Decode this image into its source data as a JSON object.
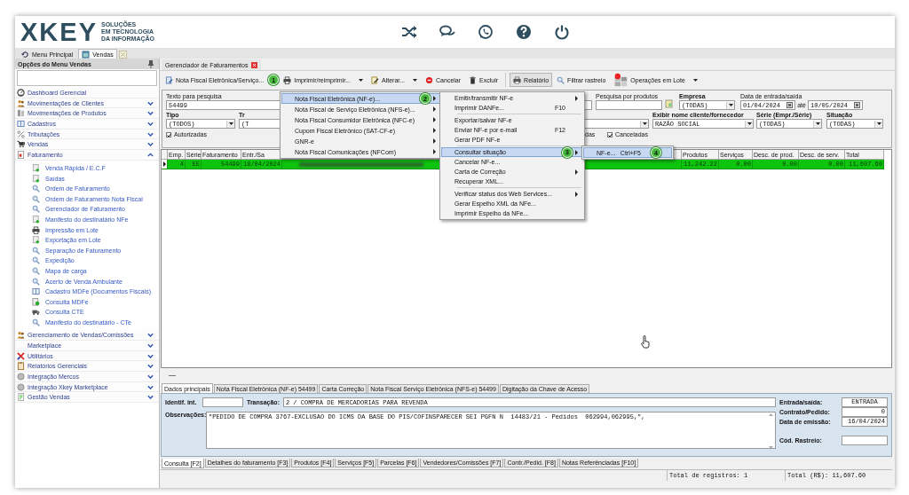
{
  "header": {
    "logo_wordmark": "XKEY",
    "logo_tagline": [
      "SOLUÇÕES",
      "EM TECNOLOGIA",
      "DA INFORMAÇÃO"
    ]
  },
  "app_tabs": [
    {
      "label": "Menu Principal",
      "selected": false
    },
    {
      "label": "Vendas",
      "selected": true
    }
  ],
  "sidebar": {
    "title": "Opções do Menu Vendas",
    "items": [
      {
        "label": "Dashboard Gerencial",
        "kind": "link"
      },
      {
        "label": "Movimentações de Clientes",
        "kind": "group",
        "expanded": false
      },
      {
        "label": "Movimentações de Produtos",
        "kind": "group",
        "expanded": false
      },
      {
        "label": "Cadastros",
        "kind": "group",
        "expanded": false
      },
      {
        "label": "Tributações",
        "kind": "group",
        "expanded": false
      },
      {
        "label": "Vendas",
        "kind": "group",
        "expanded": false
      },
      {
        "label": "Faturamento",
        "kind": "group",
        "expanded": true,
        "children": [
          {
            "label": "Venda Rápida / E.C.F",
            "kind": "add"
          },
          {
            "label": "Saídas",
            "kind": "add"
          },
          {
            "label": "Ordem de Faturamento",
            "kind": "search"
          },
          {
            "label": "Ordem de Faturamento Nota Fiscal",
            "kind": "search"
          },
          {
            "label": "Gerenciador de Faturamento",
            "kind": "search"
          },
          {
            "label": "Manifesto do destinatário NFe",
            "kind": "add"
          },
          {
            "label": "Impressão em Lote",
            "kind": "printer"
          },
          {
            "label": "Exportação em Lote",
            "kind": "add"
          },
          {
            "label": "Separação de Faturamento",
            "kind": "search"
          },
          {
            "label": "Expedição",
            "kind": "search"
          },
          {
            "label": "Mapa de carga",
            "kind": "search"
          },
          {
            "label": "Acerto de Venda Ambulante",
            "kind": "search"
          },
          {
            "label": "Cadastro MDFe (Documentos Fiscais)",
            "kind": "book"
          },
          {
            "label": "Consulta MDFe",
            "kind": "consult"
          },
          {
            "label": "Consulta CTE",
            "kind": "truck"
          },
          {
            "label": "Manifesto do destinatário - CTe",
            "kind": "search"
          }
        ]
      },
      {
        "label": "Gerenciamento de Vendas/Comissões",
        "kind": "group",
        "expanded": false
      },
      {
        "label": "Marketplace",
        "kind": "group",
        "expanded": false
      },
      {
        "label": "Utilitários",
        "kind": "group",
        "expanded": false
      },
      {
        "label": "Relatórios Gerenciais",
        "kind": "group",
        "expanded": false
      },
      {
        "label": "Integração Mercos",
        "kind": "group",
        "expanded": false
      },
      {
        "label": "Integração Xkey Marketplace",
        "kind": "group",
        "expanded": false
      },
      {
        "label": "Gestão Vendas",
        "kind": "group",
        "expanded": false
      }
    ]
  },
  "document_tab": {
    "label": "Gerenciador de Faturamentos"
  },
  "toolbar": [
    {
      "label": "Nota Fiscal Eletrônica/Serviço...",
      "kind": "nfe",
      "dropdown": false,
      "pressed": false,
      "badge": "1"
    },
    {
      "label": "Imprimir/reimprimir...",
      "kind": "print",
      "dropdown": true,
      "pressed": false
    },
    {
      "label": "Alterar...",
      "kind": "edit",
      "dropdown": true,
      "pressed": false
    },
    {
      "label": "Cancelar",
      "kind": "cancel",
      "dropdown": false,
      "pressed": false
    },
    {
      "label": "Excluir",
      "kind": "delete",
      "dropdown": false,
      "pressed": false
    },
    {
      "label": "Relatório",
      "kind": "report",
      "dropdown": false,
      "pressed": true
    },
    {
      "label": "Filtrar rastreio",
      "kind": "filter",
      "dropdown": false,
      "pressed": false
    },
    {
      "label": "Operações em Lote",
      "kind": "batch",
      "dropdown": true,
      "pressed": false
    }
  ],
  "filters": {
    "search_text": {
      "label": "Texto para pesquisa",
      "value": "54499"
    },
    "product_search": {
      "label": "Pesquisa por produtos"
    },
    "company": {
      "label": "Empresa",
      "value": "(TODAS)"
    },
    "date_range": {
      "label": "Data de entrada/saída",
      "from": "01/04/2024",
      "separator": "até",
      "to": "10/05/2024"
    },
    "type": {
      "label": "Tipo",
      "value": "(TODOS)"
    },
    "type_2": {
      "label": "Tr",
      "value": "(T"
    },
    "display_name": {
      "label": "Exibir nome cliente/fornecedor",
      "value": "RAZÃO SOCIAL"
    },
    "series": {
      "label": "Série (Empr./Série)",
      "value": "(TODAS)"
    },
    "status": {
      "label": "Situação",
      "value": "(TODAS)"
    },
    "checkbox_authorized": {
      "label": "Autorizadas",
      "checked": true
    },
    "partial_label": "das",
    "checkbox_cancelled": {
      "label": "Canceladas",
      "checked": true
    }
  },
  "grid": {
    "columns": [
      "Emp.",
      "Série",
      "Faturamento",
      "Entr./Sa",
      "Produtos",
      "Serviços",
      "Desc. de prod.",
      "Desc. de serv.",
      "Total"
    ],
    "rows": [
      {
        "current": true,
        "cells": [
          "4",
          "EE",
          "54499",
          "18/04/2024",
          "11,242.22",
          "0.00",
          "0.00",
          "0.00",
          "11,607.60"
        ]
      }
    ]
  },
  "context_menus": [
    {
      "items": [
        {
          "label": "Nota Fiscal Eletrônica (NF-e)...",
          "submenu": true,
          "selected": true,
          "separator_before": false,
          "badge": "2"
        },
        {
          "label": "Nota Fiscal de Serviço Eletrônica (NFS-e)...",
          "submenu": true,
          "selected": false,
          "separator_before": false
        },
        {
          "label": "Nota Fiscal Consumidor Eletrônica (NFC-e)",
          "submenu": true,
          "selected": false,
          "separator_before": false
        },
        {
          "label": "Cupom Fiscal Eletrônico (SAT-CF-e)",
          "submenu": true,
          "selected": false,
          "separator_before": false
        },
        {
          "label": "GNR-e",
          "submenu": true,
          "selected": false,
          "separator_before": false
        },
        {
          "label": "Nota Fiscal Comunicações (NFCom)",
          "submenu": true,
          "selected": false,
          "separator_before": false
        }
      ]
    },
    {
      "items": [
        {
          "label": "Emitir/transmitir NF-e",
          "submenu": true,
          "selected": false,
          "separator_before": false
        },
        {
          "label": "Imprimir DANFe...",
          "shortcut": "F10",
          "submenu": false,
          "selected": false,
          "separator_before": false
        },
        {
          "label": "Exportar/salvar NF-e",
          "submenu": false,
          "selected": false,
          "separator_before": true
        },
        {
          "label": "Enviar NF-e por e-mail",
          "shortcut": "F12",
          "submenu": false,
          "selected": false,
          "separator_before": false
        },
        {
          "label": "Gerar PDF NF-e",
          "submenu": false,
          "selected": false,
          "separator_before": false
        },
        {
          "label": "Consultar situação",
          "submenu": true,
          "selected": true,
          "separator_before": true,
          "badge": "3"
        },
        {
          "label": "Cancelar NF-e...",
          "submenu": false,
          "selected": false,
          "separator_before": false
        },
        {
          "label": "Carta de Correção",
          "submenu": true,
          "selected": false,
          "separator_before": false
        },
        {
          "label": "Recuperar XML...",
          "submenu": false,
          "selected": false,
          "separator_before": false
        },
        {
          "label": "Verificar status dos Web Services...",
          "submenu": true,
          "selected": false,
          "separator_before": true
        },
        {
          "label": "Gerar Espelho XML da NFe...",
          "submenu": false,
          "selected": false,
          "separator_before": false
        },
        {
          "label": "Imprimir Espelho da NFe...",
          "submenu": false,
          "selected": false,
          "separator_before": false
        }
      ]
    },
    {
      "items": [
        {
          "label": "NF-e...",
          "shortcut": "Ctrl+F5",
          "submenu": false,
          "selected": true,
          "separator_before": false,
          "badge": "4"
        }
      ]
    }
  ],
  "details": {
    "tabs": [
      {
        "label": "Dados principais",
        "selected": true
      },
      {
        "label": "Nota Fiscal Eletrônica (NF-e) 54499",
        "selected": false
      },
      {
        "label": "Carta Correção",
        "selected": false
      },
      {
        "label": "Nota Fiscal Serviço Eletrônica (NFS-e) 54499",
        "selected": false
      },
      {
        "label": "Digitação da Chave de Acesso",
        "selected": false
      }
    ],
    "internal_id": {
      "label": "Identif. int."
    },
    "transaction": {
      "label": "Transação:",
      "value": "2 / COMPRA DE MERCADORIAS PARA REVENDA"
    },
    "notes": {
      "label": "Observações:",
      "value": "\"PEDIDO DE COMPRA 3767-EXCLUSAO DO ICMS DA BASE DO PIS/COFINSPARECER SEI PGFN N  14483/21 - Pedidos  062994,062995,\","
    },
    "side_fields": [
      {
        "label": "Entrada/saída:",
        "value": "ENTRADA"
      },
      {
        "label": "Contrato/Pedido:",
        "value": "0"
      },
      {
        "label": "Data de emissão:",
        "value": "16/04/2024"
      },
      {
        "label": "Cód. Rastreio:"
      }
    ]
  },
  "bottom_tabs": [
    {
      "label": "Consulta [F2]",
      "selected": true
    },
    {
      "label": "Detalhes do faturamento [F3]",
      "selected": false
    },
    {
      "label": "Produtos [F4]",
      "selected": false
    },
    {
      "label": "Serviços [F5]",
      "selected": false
    },
    {
      "label": "Parcelas [F6]",
      "selected": false
    },
    {
      "label": "Vendedores/Comissões [F7]",
      "selected": false
    },
    {
      "label": "Contr./Pedid. [F8]",
      "selected": false
    },
    {
      "label": "Notas Referênciadas [F10]",
      "selected": false
    }
  ],
  "status_bar": {
    "records": "Total de registros: 1",
    "total": "Total (R$): 11,607.60"
  }
}
